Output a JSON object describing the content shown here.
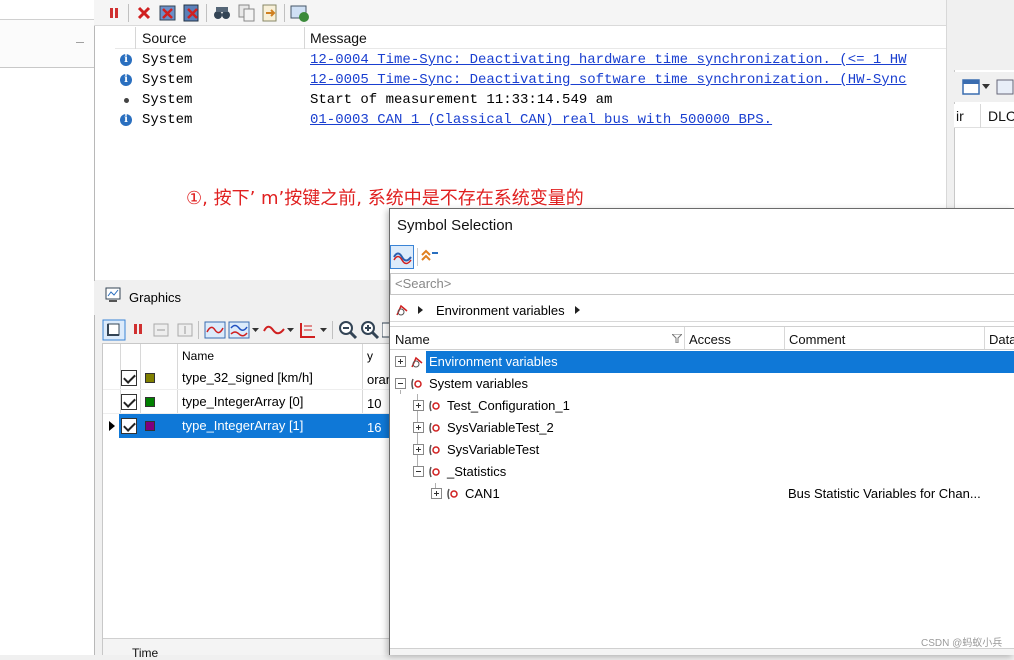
{
  "write_window": {
    "columns": {
      "source": "Source",
      "message": "Message"
    },
    "rows": [
      {
        "icon": "info-icon",
        "source": "System",
        "message": "12-0004 Time-Sync: Deactivating hardware time synchronization. (<= 1 HW",
        "link": true
      },
      {
        "icon": "info-icon",
        "source": "System",
        "message": "12-0005 Time-Sync: Deactivating software time synchronization. (HW-Sync",
        "link": true
      },
      {
        "icon": "dot-icon",
        "source": "System",
        "message": "Start of measurement 11:33:14.549 am",
        "link": false
      },
      {
        "icon": "info-icon",
        "source": "System",
        "message": "01-0003 CAN 1 (Classical CAN)  real bus with 500000 BPS.",
        "link": true
      }
    ],
    "annotation": "①, 按下’ m’按键之前, 系统中是不存在系统变量的"
  },
  "right_pane": {
    "col_a": "ir",
    "col_b": "DLC"
  },
  "graphics": {
    "title": "Graphics",
    "columns": {
      "name": "Name",
      "y": "y"
    },
    "signals": [
      {
        "name": "type_32_signed [km/h]",
        "y": "oran",
        "color": "#808000",
        "checked": true,
        "selected": false
      },
      {
        "name": "type_IntegerArray [0]",
        "y": "10",
        "color": "#008000",
        "checked": true,
        "selected": false
      },
      {
        "name": "type_IntegerArray [1]",
        "y": "16",
        "color": "#800080",
        "checked": true,
        "selected": true
      }
    ],
    "time_label": "Time"
  },
  "symbol_selection": {
    "title": "Symbol Selection",
    "search_placeholder": "<Search>",
    "breadcrumb": "Environment variables",
    "columns": {
      "name": "Name",
      "access": "Access",
      "comment": "Comment",
      "data": "Data"
    },
    "tree": [
      {
        "label": "Environment variables",
        "comment": "",
        "selected": true,
        "expanded": false
      },
      {
        "label": "System variables",
        "comment": "",
        "selected": false,
        "expanded": true
      },
      {
        "label": "Test_Configuration_1",
        "comment": "",
        "selected": false,
        "expanded": false
      },
      {
        "label": "SysVariableTest_2",
        "comment": "",
        "selected": false,
        "expanded": false
      },
      {
        "label": "SysVariableTest",
        "comment": "",
        "selected": false,
        "expanded": false
      },
      {
        "label": "_Statistics",
        "comment": "",
        "selected": false,
        "expanded": true
      },
      {
        "label": "CAN1",
        "comment": "Bus Statistic Variables for Chan...",
        "selected": false,
        "expanded": false
      }
    ]
  },
  "watermark": "CSDN @蚂蚁小兵",
  "colors": {
    "accent": "#0f78d7",
    "link": "#1a3fd0",
    "annotation": "#e02020"
  }
}
